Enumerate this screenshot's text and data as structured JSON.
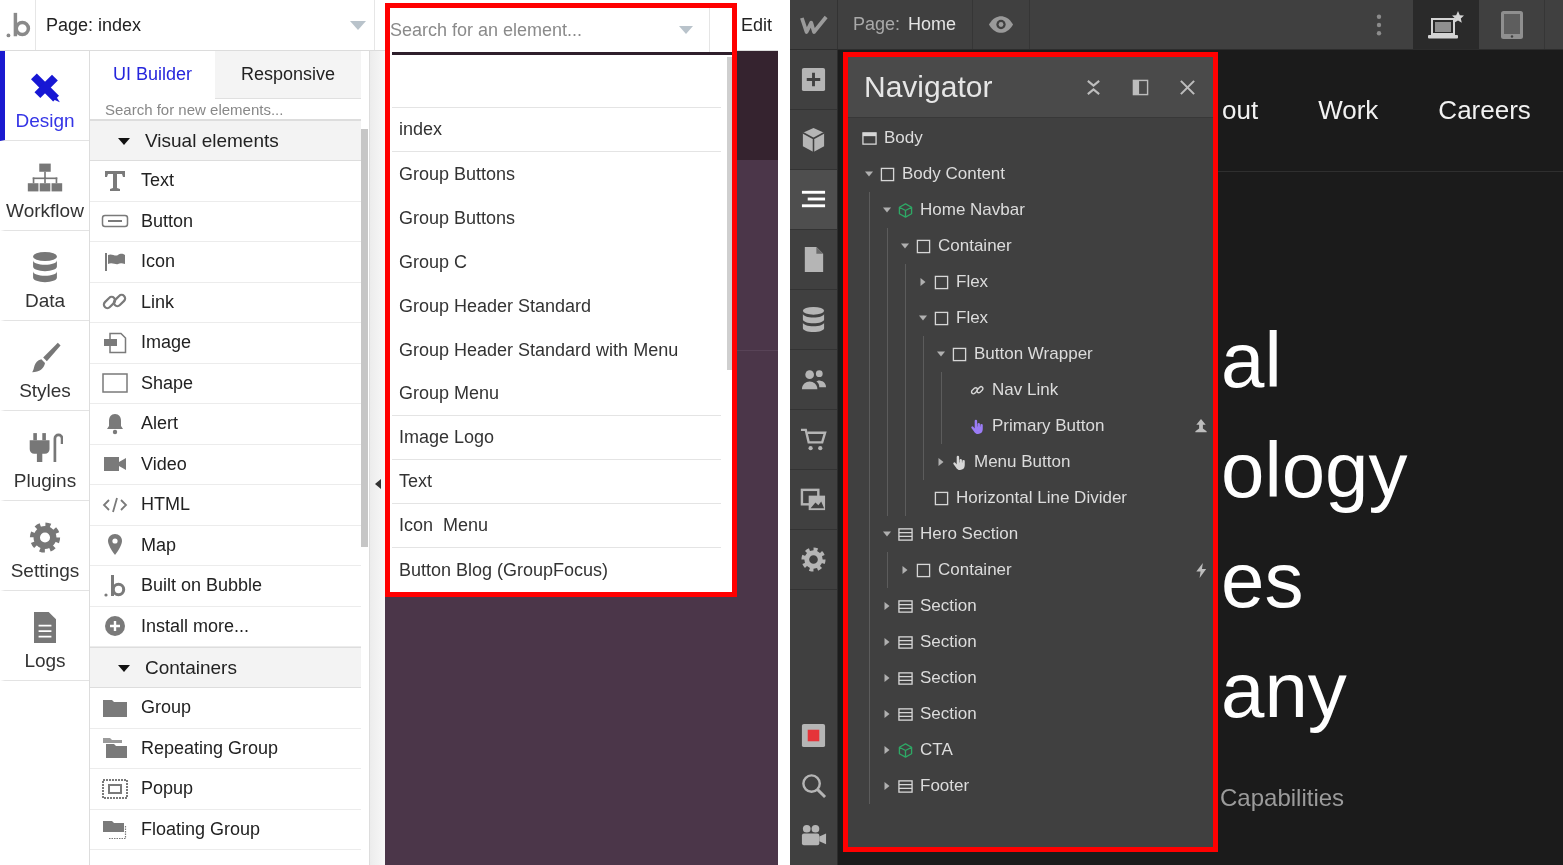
{
  "bubble": {
    "page_selector": "Page: index",
    "element_search": {
      "placeholder": "Search for an element..."
    },
    "edit_menu": "Edit",
    "nav": [
      {
        "kind": "design",
        "label": "Design",
        "selected": true
      },
      {
        "kind": "workflow",
        "label": "Workflow",
        "selected": false
      },
      {
        "kind": "data",
        "label": "Data",
        "selected": false
      },
      {
        "kind": "styles",
        "label": "Styles",
        "selected": false
      },
      {
        "kind": "plugins",
        "label": "Plugins",
        "selected": false
      },
      {
        "kind": "settings",
        "label": "Settings",
        "selected": false
      },
      {
        "kind": "logs",
        "label": "Logs",
        "selected": false
      }
    ],
    "tabs": [
      {
        "label": "UI Builder",
        "selected": true
      },
      {
        "label": "Responsive",
        "selected": false
      }
    ],
    "palette_search": {
      "placeholder": "Search for new elements..."
    },
    "categories": [
      {
        "title": "Visual elements",
        "expanded": true,
        "items": [
          {
            "kind": "text",
            "label": "Text"
          },
          {
            "kind": "button",
            "label": "Button"
          },
          {
            "kind": "icon",
            "label": "Icon"
          },
          {
            "kind": "link",
            "label": "Link"
          },
          {
            "kind": "image",
            "label": "Image"
          },
          {
            "kind": "shape",
            "label": "Shape"
          },
          {
            "kind": "alert",
            "label": "Alert"
          },
          {
            "kind": "video",
            "label": "Video"
          },
          {
            "kind": "html",
            "label": "HTML"
          },
          {
            "kind": "map",
            "label": "Map"
          },
          {
            "kind": "bubble",
            "label": "Built on Bubble"
          },
          {
            "kind": "install",
            "label": "Install more..."
          }
        ]
      },
      {
        "title": "Containers",
        "expanded": true,
        "items": [
          {
            "kind": "group",
            "label": "Group"
          },
          {
            "kind": "repeating_group",
            "label": "Repeating Group"
          },
          {
            "kind": "popup",
            "label": "Popup"
          },
          {
            "kind": "floating_group",
            "label": "Floating Group"
          }
        ]
      }
    ],
    "element_dropdown": [
      {
        "label": "index",
        "divider": true
      },
      {
        "label": "Group Buttons",
        "divider": false
      },
      {
        "label": "Group Buttons",
        "divider": false
      },
      {
        "label": "Group C",
        "divider": false
      },
      {
        "label": "Group Header Standard",
        "divider": false
      },
      {
        "label": "Group Header Standard with Menu",
        "divider": false
      },
      {
        "label": "Group Menu",
        "divider": true
      },
      {
        "label": "Image Logo",
        "divider": true
      },
      {
        "label": "Text",
        "divider": true
      },
      {
        "label": "Icon  Menu",
        "divider": true
      },
      {
        "label": "Button Blog (GroupFocus)",
        "divider": false
      }
    ]
  },
  "webflow": {
    "page_label": "Page:",
    "page_name": "Home",
    "devices": [
      {
        "kind": "desktop",
        "selected": true
      },
      {
        "kind": "tablet",
        "selected": false
      }
    ],
    "toolbar": {
      "top": [
        {
          "kind": "add",
          "selected": false
        },
        {
          "kind": "components",
          "selected": false
        },
        {
          "kind": "navigator",
          "selected": true
        },
        {
          "kind": "pages",
          "selected": false
        },
        {
          "kind": "cms",
          "selected": false
        },
        {
          "kind": "users",
          "selected": false
        },
        {
          "kind": "ecommerce",
          "selected": false
        },
        {
          "kind": "assets",
          "selected": false
        },
        {
          "kind": "settings",
          "selected": false
        }
      ],
      "bottom": [
        {
          "kind": "record",
          "selected": false
        },
        {
          "kind": "search",
          "selected": false
        },
        {
          "kind": "video",
          "selected": false
        }
      ]
    },
    "navigator": {
      "title": "Navigator",
      "tree": [
        {
          "label": "Body",
          "kind": "body",
          "children": [
            {
              "label": "Body Content",
              "kind": "div",
              "expanded": true,
              "children": [
                {
                  "label": "Home Navbar",
                  "kind": "component",
                  "expanded": true,
                  "children": [
                    {
                      "label": "Container",
                      "kind": "div",
                      "expanded": true,
                      "children": [
                        {
                          "label": "Flex",
                          "kind": "div",
                          "expanded": false
                        },
                        {
                          "label": "Flex",
                          "kind": "div",
                          "expanded": true,
                          "children": [
                            {
                              "label": "Button Wrapper",
                              "kind": "div",
                              "expanded": true,
                              "children": [
                                {
                                  "label": "Nav Link",
                                  "kind": "link"
                                },
                                {
                                  "label": "Primary Button",
                                  "kind": "button",
                                  "color": "#9b7cf6",
                                  "interaction": {
                                    "kind": "target"
                                  }
                                }
                              ]
                            },
                            {
                              "label": "Menu Button",
                              "kind": "button",
                              "expanded": false
                            }
                          ]
                        },
                        {
                          "label": "Horizontal Line Divider",
                          "kind": "div"
                        }
                      ]
                    }
                  ]
                },
                {
                  "label": "Hero Section",
                  "kind": "section",
                  "expanded": true,
                  "children": [
                    {
                      "label": "Container",
                      "kind": "div",
                      "expanded": false,
                      "interaction": {
                        "kind": "trigger"
                      }
                    }
                  ]
                },
                {
                  "label": "Section",
                  "kind": "section",
                  "expanded": false
                },
                {
                  "label": "Section",
                  "kind": "section",
                  "expanded": false
                },
                {
                  "label": "Section",
                  "kind": "section",
                  "expanded": false
                },
                {
                  "label": "Section",
                  "kind": "section",
                  "expanded": false
                },
                {
                  "label": "CTA",
                  "kind": "component",
                  "expanded": false
                },
                {
                  "label": "Footer",
                  "kind": "section",
                  "expanded": false
                }
              ]
            }
          ]
        }
      ]
    },
    "canvas": {
      "nav_links": [
        "out",
        "Work",
        "Careers"
      ],
      "hero_heading_lines": [
        "al",
        "ology",
        "es",
        "any"
      ],
      "subtitle": "Capabilities"
    }
  }
}
